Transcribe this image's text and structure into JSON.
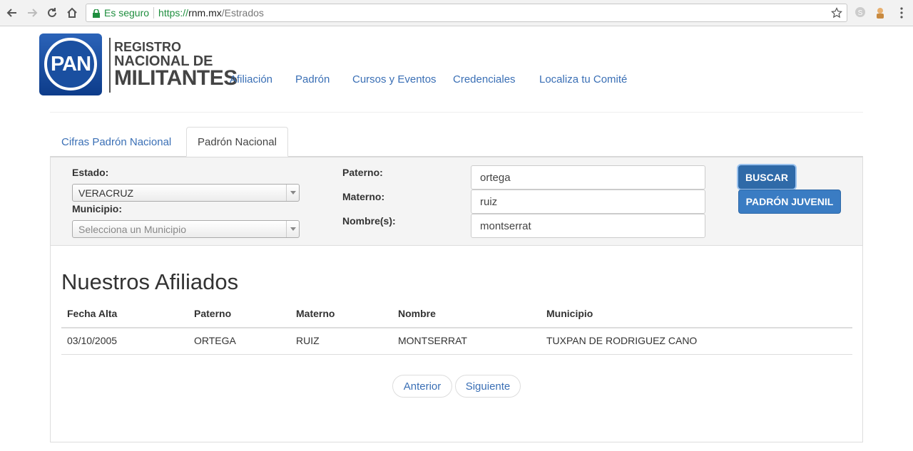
{
  "browser": {
    "secure_label": "Es seguro",
    "url_scheme": "https://",
    "url_host": "rnm.mx",
    "url_path": "/Estrados"
  },
  "header": {
    "logo_text": "PAN",
    "title_line1": "REGISTRO",
    "title_line2": "NACIONAL DE",
    "title_line3": "MILITANTES",
    "nav": [
      "Afiliación",
      "Padrón",
      "Cursos y Eventos",
      "Credenciales",
      "Localiza tu Comité"
    ]
  },
  "tabs": [
    {
      "label": "Cifras Padrón Nacional",
      "active": false
    },
    {
      "label": "Padrón Nacional",
      "active": true
    }
  ],
  "filters": {
    "estado_label": "Estado:",
    "estado_value": "VERACRUZ",
    "municipio_label": "Municipio:",
    "municipio_placeholder": "Selecciona un Municipio",
    "paterno_label": "Paterno:",
    "paterno_value": "ortega",
    "materno_label": "Materno:",
    "materno_value": "ruiz",
    "nombre_label": "Nombre(s):",
    "nombre_value": "montserrat",
    "buscar_label": "BUSCAR",
    "juvenil_label": "PADRÓN JUVENIL"
  },
  "results": {
    "title": "Nuestros Afiliados",
    "columns": [
      "Fecha Alta",
      "Paterno",
      "Materno",
      "Nombre",
      "Municipio"
    ],
    "rows": [
      [
        "03/10/2005",
        "ORTEGA",
        "RUIZ",
        "MONTSERRAT",
        "TUXPAN DE RODRIGUEZ CANO"
      ]
    ]
  },
  "pagination": {
    "prev_label": "Anterior",
    "next_label": "Siguiente"
  },
  "colors": {
    "link": "#3a6fb5",
    "button": "#3a7cc3",
    "secure_green": "#1e8e3e"
  }
}
